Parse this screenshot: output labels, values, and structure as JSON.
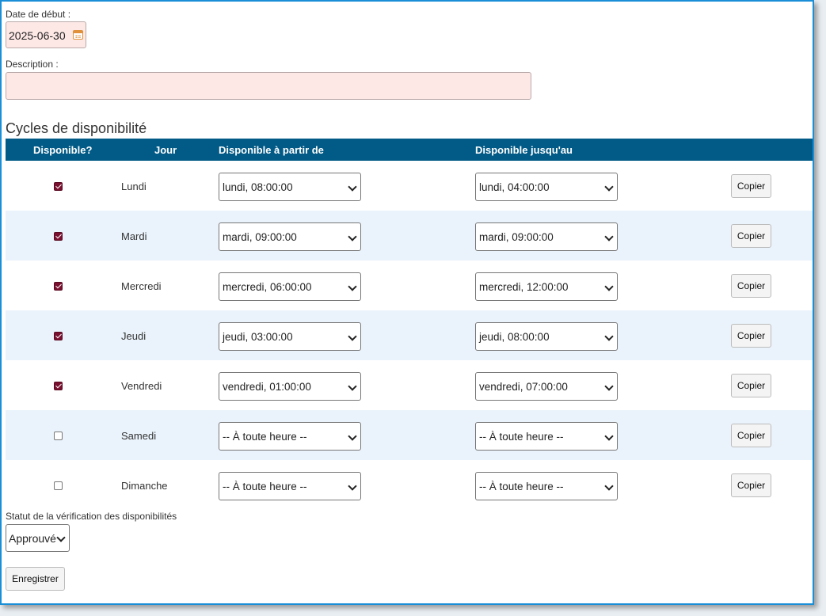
{
  "start_date": {
    "label": "Date de début :",
    "value": "2025-06-30"
  },
  "description": {
    "label": "Description :",
    "value": ""
  },
  "cycles": {
    "title": "Cycles de disponibilité",
    "headers": {
      "available": "Disponible?",
      "day": "Jour",
      "from": "Disponible à partir de",
      "until": "Disponible jusqu'au"
    },
    "copy_label": "Copier",
    "rows": [
      {
        "checked": true,
        "day": "Lundi",
        "from": "lundi, 08:00:00",
        "until": "lundi, 04:00:00"
      },
      {
        "checked": true,
        "day": "Mardi",
        "from": "mardi, 09:00:00",
        "until": "mardi, 09:00:00"
      },
      {
        "checked": true,
        "day": "Mercredi",
        "from": "mercredi, 06:00:00",
        "until": "mercredi, 12:00:00"
      },
      {
        "checked": true,
        "day": "Jeudi",
        "from": "jeudi, 03:00:00",
        "until": "jeudi, 08:00:00"
      },
      {
        "checked": true,
        "day": "Vendredi",
        "from": "vendredi, 01:00:00",
        "until": "vendredi, 07:00:00"
      },
      {
        "checked": false,
        "day": "Samedi",
        "from": "-- À toute heure --",
        "until": "-- À toute heure --"
      },
      {
        "checked": false,
        "day": "Dimanche",
        "from": "-- À toute heure --",
        "until": "-- À toute heure --"
      }
    ]
  },
  "status": {
    "label": "Statut de la vérification des disponibilités",
    "value": "Approuvé"
  },
  "save_label": "Enregistrer",
  "colors": {
    "header_bg": "#025a86",
    "row_alt_bg": "#eaf3fb",
    "required_field_bg": "#fde8e6",
    "checkbox": "#7a1030",
    "frame_border": "#1a8fd8"
  }
}
